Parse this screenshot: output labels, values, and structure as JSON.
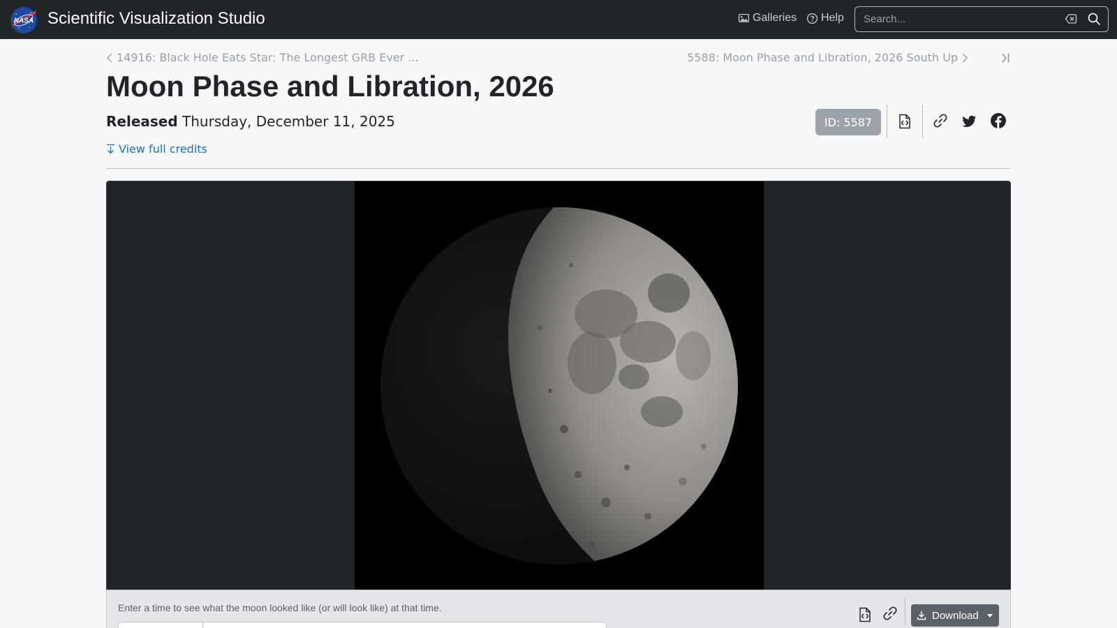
{
  "header": {
    "logo_text": "NASA",
    "site_title": "Scientific Visualization Studio",
    "nav": [
      {
        "label": "Galleries",
        "icon": "gallery-icon"
      },
      {
        "label": "Help",
        "icon": "help-icon"
      }
    ],
    "search": {
      "placeholder": "Search...",
      "value": ""
    }
  },
  "pager": {
    "prev_label": "14916: Black Hole Eats Star: The Longest GRB Ever ...",
    "next_label": "5588: Moon Phase and Libration, 2026 South Up"
  },
  "page": {
    "title": "Moon Phase and Libration, 2026",
    "released_label": "Released",
    "released_date": "Thursday, December 11, 2025",
    "credits_link": "View full credits",
    "id_badge": "ID: 5587"
  },
  "media": {
    "hint": "Enter a time to see what the moon looked like (or will look like) at that time.",
    "download_label": "Download"
  },
  "colors": {
    "navbar": "#212529",
    "link": "#1f6fbf",
    "badge": "#9ca3ab",
    "button": "#5a6168"
  }
}
